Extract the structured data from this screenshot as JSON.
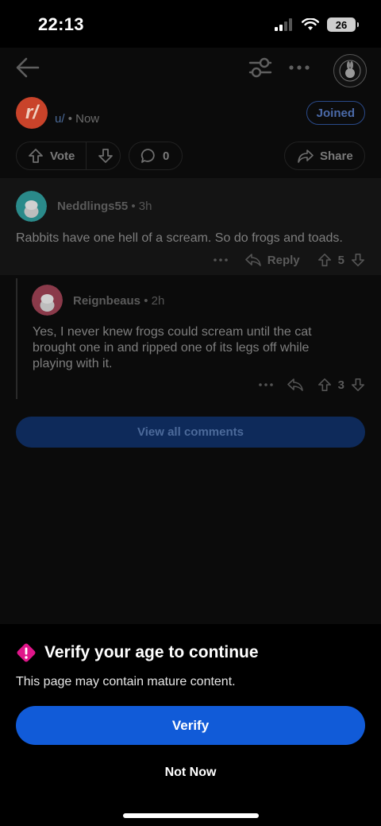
{
  "status_bar": {
    "time": "22:13",
    "battery": "26"
  },
  "post": {
    "subreddit_logo_letter": "r/",
    "user_prefix": "u/",
    "separator": "•",
    "time": "Now",
    "joined_label": "Joined",
    "vote_label": "Vote",
    "comment_count": "0",
    "share_label": "Share"
  },
  "comments": [
    {
      "username": "Neddlings55",
      "time": "3h",
      "body": "Rabbits have one hell of a scream. So do frogs and toads.",
      "reply_label": "Reply",
      "votes": "5",
      "avatar_color": "#2a8a8a"
    },
    {
      "username": "Reignbeaus",
      "time": "2h",
      "body": "Yes, I never knew frogs could scream until the cat brought one in and ripped one of its legs off while playing with it.",
      "votes": "3",
      "avatar_color": "#8a3a4a"
    }
  ],
  "view_all_label": "View all comments",
  "sheet": {
    "title": "Verify your age to continue",
    "body": "This page may contain mature content.",
    "verify_label": "Verify",
    "not_now_label": "Not Now",
    "accent_color": "#e0168a",
    "button_color": "#115bd8"
  }
}
